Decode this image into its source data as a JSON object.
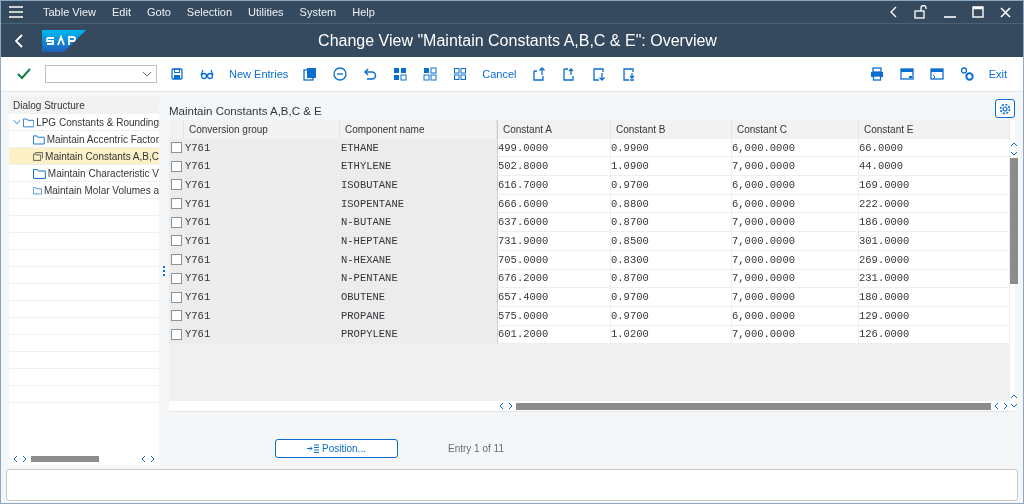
{
  "menu": [
    "Table View",
    "Edit",
    "Goto",
    "Selection",
    "Utilities",
    "System",
    "Help"
  ],
  "title": "Change View \"Maintain Constants A,B,C & E\": Overview",
  "toolbar": {
    "new_button": "New Entries",
    "cancel_button": "Cancel",
    "exit_button": "Exit"
  },
  "dialog_structure": {
    "title": "Dialog Structure",
    "tree": [
      {
        "label": "LPG Constants & Rounding",
        "expanded": true,
        "selected": false,
        "children": [
          {
            "label": "Maintain Accentric Factor",
            "selected": false
          },
          {
            "label": "Maintain Constants A,B,C",
            "selected": true
          },
          {
            "label": "Maintain Characteristic V",
            "selected": false
          },
          {
            "label": "Maintain Molar Volumes a",
            "selected": false
          }
        ]
      }
    ]
  },
  "table": {
    "title": "Maintain Constants A,B,C & E",
    "columns": [
      "Conversion group",
      "Component name",
      "Constant A",
      "Constant B",
      "Constant C",
      "Constant E"
    ],
    "rows": [
      {
        "checked": false,
        "cells": [
          "Y761",
          "ETHANE",
          "499.0000",
          "0.9900",
          "6,000.0000",
          "66.0000"
        ]
      },
      {
        "checked": false,
        "cells": [
          "Y761",
          "ETHYLENE",
          "502.8000",
          "1.0900",
          "7,000.0000",
          "44.0000"
        ]
      },
      {
        "checked": false,
        "cells": [
          "Y761",
          "ISOBUTANE",
          "616.7000",
          "0.9700",
          "6,000.0000",
          "169.0000"
        ]
      },
      {
        "checked": false,
        "cells": [
          "Y761",
          "ISOPENTANE",
          "666.6000",
          "0.8800",
          "6,000.0000",
          "222.0000"
        ]
      },
      {
        "checked": false,
        "cells": [
          "Y761",
          "N-BUTANE",
          "637.6000",
          "0.8700",
          "7,000.0000",
          "186.0000"
        ]
      },
      {
        "checked": false,
        "cells": [
          "Y761",
          "N-HEPTANE",
          "731.9000",
          "0.8500",
          "7,000.0000",
          "301.0000"
        ]
      },
      {
        "checked": false,
        "cells": [
          "Y761",
          "N-HEXANE",
          "705.0000",
          "0.8300",
          "7,000.0000",
          "269.0000"
        ]
      },
      {
        "checked": false,
        "cells": [
          "Y761",
          "N-PENTANE",
          "676.2000",
          "0.8700",
          "7,000.0000",
          "231.0000"
        ]
      },
      {
        "checked": false,
        "cells": [
          "Y761",
          "OBUTENE",
          "657.4000",
          "0.9700",
          "7,000.0000",
          "180.0000"
        ]
      },
      {
        "checked": false,
        "cells": [
          "Y761",
          "PROPANE",
          "575.0000",
          "0.9700",
          "6,000.0000",
          "129.0000"
        ]
      },
      {
        "checked": false,
        "cells": [
          "Y761",
          "PROPYLENE",
          "601.2000",
          "1.0200",
          "7,000.0000",
          "126.0000"
        ]
      }
    ]
  },
  "position_button": "Position...",
  "entry_info": "Entry 1 of 11"
}
